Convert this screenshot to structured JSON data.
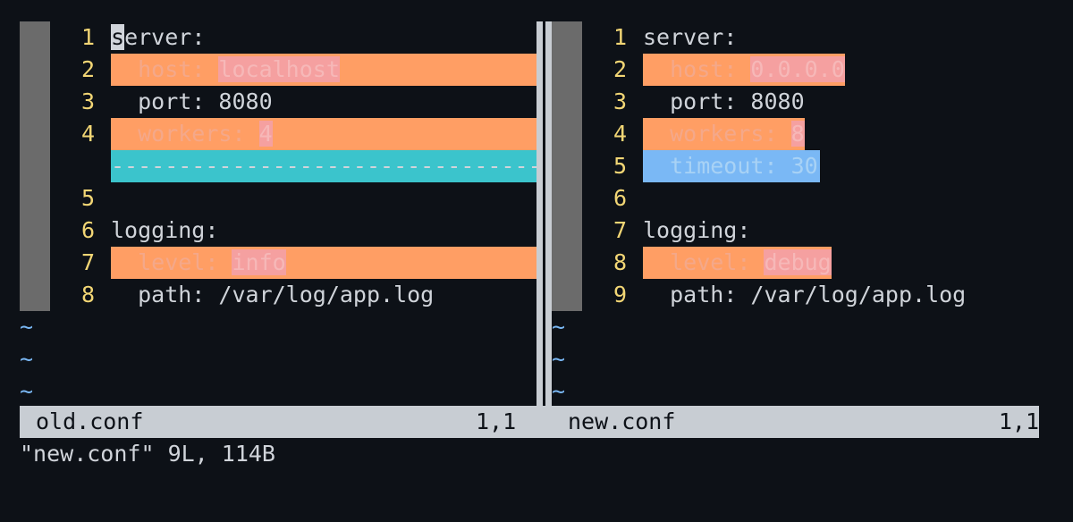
{
  "left": {
    "filename": "old.conf",
    "position": "1,1",
    "rows": [
      {
        "num": "1",
        "type": "normal",
        "cursor": "s",
        "segments": [
          {
            "text": "erver:",
            "hl": false
          }
        ]
      },
      {
        "num": "2",
        "type": "changed",
        "segments": [
          {
            "text": "  host: ",
            "hl": false
          },
          {
            "text": "localhost",
            "hl": true
          }
        ]
      },
      {
        "num": "3",
        "type": "normal",
        "segments": [
          {
            "text": "  port: 8080",
            "hl": false
          }
        ]
      },
      {
        "num": "4",
        "type": "changed",
        "segments": [
          {
            "text": "  workers: ",
            "hl": false
          },
          {
            "text": "4",
            "hl": true
          }
        ]
      },
      {
        "num": "",
        "type": "filler",
        "segments": [
          {
            "text": "------------------------------------------",
            "hl": false
          }
        ]
      },
      {
        "num": "5",
        "type": "normal",
        "segments": [
          {
            "text": "",
            "hl": false
          }
        ]
      },
      {
        "num": "6",
        "type": "normal",
        "segments": [
          {
            "text": "logging:",
            "hl": false
          }
        ]
      },
      {
        "num": "7",
        "type": "changed",
        "segments": [
          {
            "text": "  level: ",
            "hl": false
          },
          {
            "text": "info",
            "hl": true
          }
        ]
      },
      {
        "num": "8",
        "type": "normal",
        "segments": [
          {
            "text": "  path: /var/log/app.log",
            "hl": false
          }
        ]
      }
    ],
    "tildes": [
      "~",
      "~",
      "~"
    ]
  },
  "right": {
    "filename": "new.conf",
    "position": "1,1",
    "rows": [
      {
        "num": "1",
        "type": "normal",
        "segments": [
          {
            "text": "server:",
            "hl": false
          }
        ]
      },
      {
        "num": "2",
        "type": "changed-short",
        "segments": [
          {
            "text": "  host: ",
            "hl": false
          },
          {
            "text": "0.0.0.0",
            "hl": true
          }
        ]
      },
      {
        "num": "3",
        "type": "normal",
        "segments": [
          {
            "text": "  port: 8080",
            "hl": false
          }
        ]
      },
      {
        "num": "4",
        "type": "changed-short",
        "segments": [
          {
            "text": "  workers: ",
            "hl": false
          },
          {
            "text": "8",
            "hl": true
          }
        ]
      },
      {
        "num": "5",
        "type": "added",
        "segments": [
          {
            "text": "  timeout: 30",
            "hl": false
          }
        ]
      },
      {
        "num": "6",
        "type": "normal",
        "segments": [
          {
            "text": "",
            "hl": false
          }
        ]
      },
      {
        "num": "7",
        "type": "normal",
        "segments": [
          {
            "text": "logging:",
            "hl": false
          }
        ]
      },
      {
        "num": "8",
        "type": "changed-short",
        "segments": [
          {
            "text": "  level: ",
            "hl": false
          },
          {
            "text": "debug",
            "hl": true
          }
        ]
      },
      {
        "num": "9",
        "type": "normal",
        "segments": [
          {
            "text": "  path: /var/log/app.log",
            "hl": false
          }
        ]
      }
    ],
    "tildes": [
      "~",
      "~",
      "~"
    ]
  },
  "cmdline": "\"new.conf\" 9L, 114B"
}
